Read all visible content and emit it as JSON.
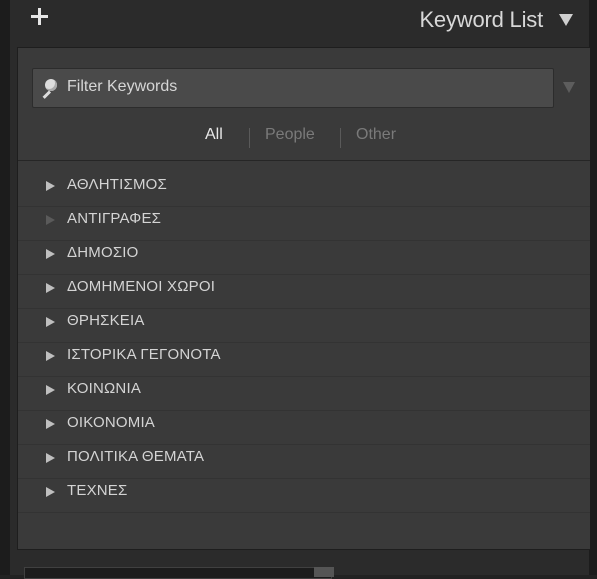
{
  "header": {
    "add_icon": "plus-icon",
    "title": "Keyword List",
    "collapse_icon": "triangle-down-icon"
  },
  "filter": {
    "icon": "magnifier-icon",
    "placeholder": "Filter Keywords",
    "dropdown_icon": "triangle-down-icon"
  },
  "tabs": [
    {
      "label": "All",
      "selected": true
    },
    {
      "label": "People",
      "selected": false
    },
    {
      "label": "Other",
      "selected": false
    }
  ],
  "keywords": [
    {
      "label": "ΑΘΛΗΤΙΣΜΟΣ",
      "expandable": true
    },
    {
      "label": "ΑΝΤΙΓΡΑΦΕΣ",
      "expandable": false
    },
    {
      "label": "ΔΗΜΟΣΙΟ",
      "expandable": true
    },
    {
      "label": "ΔΟΜΗΜΕΝΟΙ ΧΩΡΟΙ",
      "expandable": true
    },
    {
      "label": "ΘΡΗΣΚΕΙΑ",
      "expandable": true
    },
    {
      "label": "ΙΣΤΟΡΙΚΑ ΓΕΓΟΝΟΤΑ",
      "expandable": true
    },
    {
      "label": "ΚΟΙΝΩΝΙΑ",
      "expandable": true
    },
    {
      "label": "ΟΙΚΟΝΟΜΙΑ",
      "expandable": true
    },
    {
      "label": "ΠΟΛΙΤΙΚΑ ΘΕΜΑΤΑ",
      "expandable": true
    },
    {
      "label": "ΤΕΧΝΕΣ",
      "expandable": true
    }
  ],
  "colors": {
    "panel_bg": "#2b2b2b",
    "content_bg": "#3a3a3a",
    "text": "#d4d4d4",
    "tab_inactive": "#7a7a7a"
  }
}
